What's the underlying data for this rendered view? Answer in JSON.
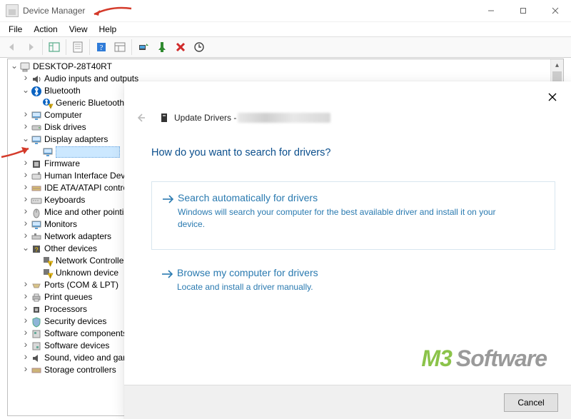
{
  "window": {
    "title": "Device Manager"
  },
  "menu": {
    "file": "File",
    "action": "Action",
    "view": "View",
    "help": "Help"
  },
  "tree": {
    "root": "DESKTOP-28T40RT",
    "items": {
      "audio": "Audio inputs and outputs",
      "bluetooth": "Bluetooth",
      "bt_generic": "Generic Bluetooth",
      "computer": "Computer",
      "disk": "Disk drives",
      "display": "Display adapters",
      "firmware": "Firmware",
      "hid": "Human Interface Devices",
      "ide": "IDE ATA/ATAPI controllers",
      "keyboards": "Keyboards",
      "mice": "Mice and other pointing devices",
      "monitors": "Monitors",
      "network": "Network adapters",
      "other": "Other devices",
      "other_netctrl": "Network Controller",
      "other_unknown": "Unknown device",
      "ports": "Ports (COM & LPT)",
      "printq": "Print queues",
      "processors": "Processors",
      "security": "Security devices",
      "softcomp": "Software components",
      "softdev": "Software devices",
      "sound": "Sound, video and game controllers",
      "storagectrl": "Storage controllers"
    }
  },
  "dialog": {
    "header_prefix": "Update Drivers - ",
    "question": "How do you want to search for drivers?",
    "opt1_title": "Search automatically for drivers",
    "opt1_desc": "Windows will search your computer for the best available driver and install it on your device.",
    "opt2_title": "Browse my computer for drivers",
    "opt2_desc": "Locate and install a driver manually.",
    "cancel": "Cancel"
  },
  "watermark": {
    "part1": "M3",
    "part2": "Software"
  }
}
